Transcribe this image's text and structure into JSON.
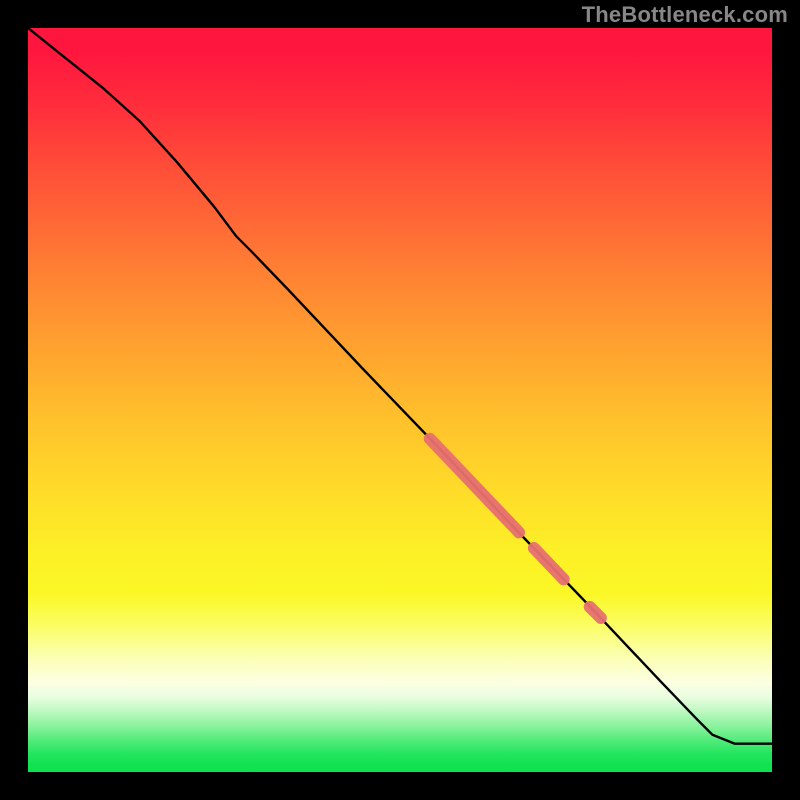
{
  "watermark": "TheBottleneck.com",
  "colors": {
    "background": "#000000",
    "line": "#000000",
    "highlight": "#e77070",
    "watermark_text": "#878787"
  },
  "chart_data": {
    "type": "line",
    "title": "",
    "xlabel": "",
    "ylabel": "",
    "xlim": [
      0,
      100
    ],
    "ylim": [
      0,
      100
    ],
    "grid": false,
    "line": {
      "x": [
        0,
        5,
        10,
        15,
        20,
        25,
        28,
        30,
        35,
        40,
        45,
        50,
        55,
        60,
        65,
        70,
        75,
        80,
        85,
        90,
        92,
        95,
        100
      ],
      "y": [
        100,
        96,
        92,
        87.5,
        82,
        76,
        72,
        70,
        64.8,
        59.5,
        54.2,
        49,
        43.8,
        38.5,
        33.2,
        28,
        22.8,
        17.5,
        12.2,
        7,
        5,
        3.8,
        3.8
      ]
    },
    "highlight_segments": [
      {
        "x0": 54,
        "y0": 44.8,
        "x1": 66,
        "y1": 32.2
      },
      {
        "x0": 68,
        "y0": 30.1,
        "x1": 72,
        "y1": 25.9
      },
      {
        "x0": 75.5,
        "y0": 22.2,
        "x1": 77.0,
        "y1": 20.7
      }
    ],
    "gradient_stops": [
      {
        "pos": 0,
        "color": "#ff163e"
      },
      {
        "pos": 10,
        "color": "#ff2c3c"
      },
      {
        "pos": 31,
        "color": "#ff7a34"
      },
      {
        "pos": 52,
        "color": "#ffbf2c"
      },
      {
        "pos": 76,
        "color": "#fbf726"
      },
      {
        "pos": 88,
        "color": "#fcffe3"
      },
      {
        "pos": 96,
        "color": "#4bea76"
      },
      {
        "pos": 100,
        "color": "#0ee14f"
      }
    ]
  }
}
